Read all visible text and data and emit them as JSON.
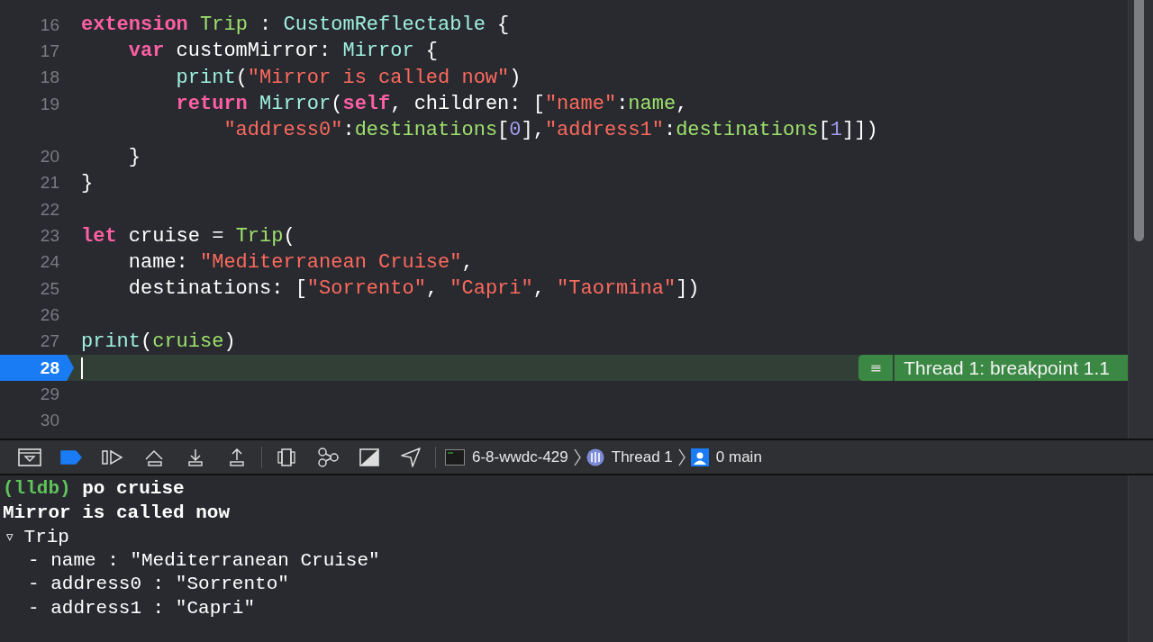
{
  "editor": {
    "lines": [
      {
        "number": "16",
        "current": false,
        "kind": "top",
        "tokens": [
          {
            "kind": "keyword",
            "text": "extension "
          },
          {
            "kind": "project",
            "text": "Trip"
          },
          {
            "kind": "plain",
            "text": " : "
          },
          {
            "kind": "type",
            "text": "CustomReflectable"
          },
          {
            "kind": "plain",
            "text": " {"
          }
        ]
      },
      {
        "number": "17",
        "current": false,
        "kind": "member",
        "tokens": [
          {
            "kind": "keyword",
            "text": "var "
          },
          {
            "kind": "plain",
            "text": "customMirror: "
          },
          {
            "kind": "type",
            "text": "Mirror"
          },
          {
            "kind": "plain",
            "text": " {"
          }
        ]
      },
      {
        "number": "18",
        "current": false,
        "kind": "body",
        "tokens": [
          {
            "kind": "type",
            "text": "print"
          },
          {
            "kind": "plain",
            "text": "("
          },
          {
            "kind": "string",
            "text": "\"Mirror is called now\""
          },
          {
            "kind": "plain",
            "text": ")"
          }
        ]
      },
      {
        "number": "19",
        "current": false,
        "kind": "body",
        "tokens": [
          {
            "kind": "keyword",
            "text": "return "
          },
          {
            "kind": "type",
            "text": "Mirror"
          },
          {
            "kind": "plain",
            "text": "("
          },
          {
            "kind": "keyword",
            "text": "self"
          },
          {
            "kind": "plain",
            "text": ", children: ["
          },
          {
            "kind": "string",
            "text": "\"name\""
          },
          {
            "kind": "plain",
            "text": ":"
          },
          {
            "kind": "project",
            "text": "name"
          },
          {
            "kind": "plain",
            "text": ","
          }
        ]
      },
      {
        "current": false,
        "kind": "wrapped",
        "tokens": [
          {
            "kind": "string",
            "text": "\"address0\""
          },
          {
            "kind": "plain",
            "text": ":"
          },
          {
            "kind": "project",
            "text": "destinations"
          },
          {
            "kind": "plain",
            "text": "["
          },
          {
            "kind": "number",
            "text": "0"
          },
          {
            "kind": "plain",
            "text": "],"
          },
          {
            "kind": "string",
            "text": "\"address1\""
          },
          {
            "kind": "plain",
            "text": ":"
          },
          {
            "kind": "project",
            "text": "destinations"
          },
          {
            "kind": "plain",
            "text": "["
          },
          {
            "kind": "number",
            "text": "1"
          },
          {
            "kind": "plain",
            "text": "]])"
          }
        ]
      },
      {
        "number": "20",
        "current": false,
        "kind": "member",
        "tokens": [
          {
            "kind": "plain",
            "text": "}"
          }
        ]
      },
      {
        "number": "21",
        "current": false,
        "kind": "top",
        "tokens": [
          {
            "kind": "plain",
            "text": "}"
          }
        ]
      },
      {
        "number": "22",
        "current": false
      },
      {
        "number": "23",
        "current": false,
        "kind": "top",
        "tokens": [
          {
            "kind": "keyword",
            "text": "let "
          },
          {
            "kind": "plain",
            "text": "cruise = "
          },
          {
            "kind": "project",
            "text": "Trip"
          },
          {
            "kind": "plain",
            "text": "("
          }
        ]
      },
      {
        "number": "24",
        "current": false,
        "kind": "member",
        "tokens": [
          {
            "kind": "plain",
            "text": "name: "
          },
          {
            "kind": "string",
            "text": "\"Mediterranean Cruise\""
          },
          {
            "kind": "plain",
            "text": ","
          }
        ]
      },
      {
        "number": "25",
        "current": false,
        "kind": "member",
        "tokens": [
          {
            "kind": "plain",
            "text": "destinations: ["
          },
          {
            "kind": "string",
            "text": "\"Sorrento\""
          },
          {
            "kind": "plain",
            "text": ", "
          },
          {
            "kind": "string",
            "text": "\"Capri\""
          },
          {
            "kind": "plain",
            "text": ", "
          },
          {
            "kind": "string",
            "text": "\"Taormina\""
          },
          {
            "kind": "plain",
            "text": "])"
          }
        ]
      },
      {
        "number": "26",
        "current": false
      },
      {
        "number": "27",
        "current": false,
        "kind": "top",
        "tokens": [
          {
            "kind": "type",
            "text": "print"
          },
          {
            "kind": "plain",
            "text": "("
          },
          {
            "kind": "project",
            "text": "cruise"
          },
          {
            "kind": "plain",
            "text": ")"
          }
        ]
      },
      {
        "number": "28",
        "current": true,
        "annotation": {
          "icon": "≡",
          "text": "Thread 1: breakpoint 1.1"
        }
      },
      {
        "number": "29",
        "current": false
      },
      {
        "number": "30",
        "current": false
      }
    ]
  },
  "debug_bar": {
    "breakpoints_active": true,
    "path": [
      {
        "kind": "app",
        "text": "6-8-wwdc-429"
      },
      {
        "kind": "thread",
        "text": "Thread 1"
      },
      {
        "kind": "frame",
        "text": "0 main"
      }
    ]
  },
  "console": {
    "lines": [
      {
        "kind": "prompt",
        "prompt": "(lldb)",
        "text": "po cruise"
      },
      {
        "kind": "output",
        "text": "Mirror is called now"
      },
      {
        "kind": "tree",
        "expander": "▿",
        "text": "Trip",
        "expanded": true,
        "children": [
          {
            "text": "- name : \"Mediterranean Cruise\""
          },
          {
            "text": "- address0 : \"Sorrento\""
          },
          {
            "text": "- address1 : \"Capri\""
          }
        ]
      }
    ]
  }
}
